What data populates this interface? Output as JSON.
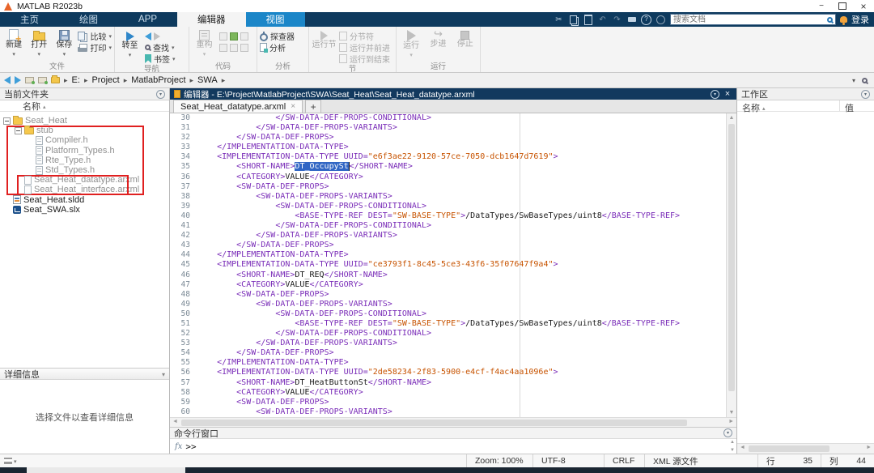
{
  "window": {
    "title": "MATLAB R2023b"
  },
  "icons": {
    "matlab-logo": "orange-triangle",
    "cut": "scissors",
    "copy": "two-pages",
    "paste": "clipboard",
    "undo": "arrow-counterclockwise",
    "redo": "arrow-clockwise",
    "print": "printer",
    "help": "question-mark",
    "community": "circle",
    "search": "magnifier",
    "bell": "notification-bell",
    "folder": "yellow-folder",
    "file": "document-page",
    "play": "triangle-right",
    "stop": "square"
  },
  "ribbon": {
    "tabs": [
      {
        "name": "home",
        "label": "主页"
      },
      {
        "name": "plots",
        "label": "绘图"
      },
      {
        "name": "apps",
        "label": "APP"
      },
      {
        "name": "editor",
        "label": "编辑器",
        "active": true
      },
      {
        "name": "view",
        "label": "视图",
        "view": true
      }
    ],
    "search_placeholder": "搜索文档",
    "signin": "登录",
    "groups": {
      "file": {
        "label": "文件",
        "new": "新建",
        "open": "打开",
        "save": "保存",
        "compare": "比较",
        "print": "打印"
      },
      "nav": {
        "label": "导航",
        "goto": "转至",
        "find": "查找",
        "bookmark": "书签"
      },
      "code": {
        "label": "代码",
        "refactor": "重构"
      },
      "analyze": {
        "label": "分析",
        "profiler": "探查器",
        "analyze": "分析"
      },
      "section": {
        "label": "节",
        "run_section": "运行节",
        "break": "分节符",
        "run_advance": "运行并前进",
        "run_end": "运行到结束"
      },
      "run": {
        "label": "运行",
        "run": "运行",
        "step": "步进",
        "stop": "停止"
      }
    }
  },
  "address_bar": {
    "path": [
      "E:",
      "Project",
      "MatlabProject",
      "SWA"
    ]
  },
  "current_folder": {
    "title": "当前文件夹",
    "name_column": "名称",
    "tree": [
      {
        "label": "Seat_Heat",
        "type": "folder",
        "level": 0,
        "expand": true,
        "gray": true
      },
      {
        "label": "stub",
        "type": "folder",
        "level": 1,
        "expand": true,
        "gray": true
      },
      {
        "label": "Compiler.h",
        "type": "hfile",
        "level": 2,
        "gray": true
      },
      {
        "label": "Platform_Types.h",
        "type": "hfile",
        "level": 2,
        "gray": true
      },
      {
        "label": "Rte_Type.h",
        "type": "hfile",
        "level": 2,
        "gray": true
      },
      {
        "label": "Std_Types.h",
        "type": "hfile",
        "level": 2,
        "gray": true
      },
      {
        "label": "Seat_Heat_datatype.arxml",
        "type": "file",
        "level": 1,
        "gray": true
      },
      {
        "label": "Seat_Heat_interface.arxml",
        "type": "file",
        "level": 1,
        "gray": true
      },
      {
        "label": "Seat_Heat.sldd",
        "type": "sldd",
        "level": 0,
        "gray": false
      },
      {
        "label": "Seat_SWA.slx",
        "type": "slx",
        "level": 0,
        "gray": false
      }
    ]
  },
  "details": {
    "title": "详细信息",
    "empty": "选择文件以查看详细信息"
  },
  "editor": {
    "titlebar": "编辑器 - E:\\Project\\MatlabProject\\SWA\\Seat_Heat\\Seat_Heat_datatype.arxml",
    "tab": "Seat_Heat_datatype.arxml",
    "lines": [
      {
        "n": "30",
        "p": [
          [
            "t",
            "                </SW-DATA-DEF-PROPS-CONDITIONAL>"
          ]
        ]
      },
      {
        "n": "31",
        "p": [
          [
            "t",
            "            </SW-DATA-DEF-PROPS-VARIANTS>"
          ]
        ]
      },
      {
        "n": "32",
        "p": [
          [
            "t",
            "        </SW-DATA-DEF-PROPS>"
          ]
        ]
      },
      {
        "n": "33",
        "p": [
          [
            "t",
            "    </IMPLEMENTATION-DATA-TYPE>"
          ]
        ]
      },
      {
        "n": "34",
        "p": [
          [
            "t",
            "    <IMPLEMENTATION-DATA-TYPE UUID="
          ],
          [
            "v",
            "\"e6f3ae22-9120-57ce-7050-dcb1647d7619\""
          ],
          [
            "t",
            ">"
          ]
        ]
      },
      {
        "n": "35",
        "p": [
          [
            "t",
            "        <SHORT-NAME>"
          ],
          [
            "s",
            "DT_OccupySt"
          ],
          [
            "t",
            "</SHORT-NAME>"
          ]
        ]
      },
      {
        "n": "36",
        "p": [
          [
            "t",
            "        <CATEGORY>"
          ],
          [
            "x",
            "VALUE"
          ],
          [
            "t",
            "</CATEGORY>"
          ]
        ]
      },
      {
        "n": "37",
        "p": [
          [
            "t",
            "        <SW-DATA-DEF-PROPS>"
          ]
        ]
      },
      {
        "n": "38",
        "p": [
          [
            "t",
            "            <SW-DATA-DEF-PROPS-VARIANTS>"
          ]
        ]
      },
      {
        "n": "39",
        "p": [
          [
            "t",
            "                <SW-DATA-DEF-PROPS-CONDITIONAL>"
          ]
        ]
      },
      {
        "n": "40",
        "p": [
          [
            "t",
            "                    <BASE-TYPE-REF DEST="
          ],
          [
            "v",
            "\"SW-BASE-TYPE\""
          ],
          [
            "t",
            ">"
          ],
          [
            "x",
            "/DataTypes/SwBaseTypes/uint8"
          ],
          [
            "t",
            "</BASE-TYPE-REF>"
          ]
        ]
      },
      {
        "n": "41",
        "p": [
          [
            "t",
            "                </SW-DATA-DEF-PROPS-CONDITIONAL>"
          ]
        ]
      },
      {
        "n": "42",
        "p": [
          [
            "t",
            "            </SW-DATA-DEF-PROPS-VARIANTS>"
          ]
        ]
      },
      {
        "n": "43",
        "p": [
          [
            "t",
            "        </SW-DATA-DEF-PROPS>"
          ]
        ]
      },
      {
        "n": "44",
        "p": [
          [
            "t",
            "    </IMPLEMENTATION-DATA-TYPE>"
          ]
        ]
      },
      {
        "n": "45",
        "p": [
          [
            "t",
            "    <IMPLEMENTATION-DATA-TYPE UUID="
          ],
          [
            "v",
            "\"ce3793f1-8c45-5ce3-43f6-35f07647f9a4\""
          ],
          [
            "t",
            ">"
          ]
        ]
      },
      {
        "n": "46",
        "p": [
          [
            "t",
            "        <SHORT-NAME>"
          ],
          [
            "x",
            "DT_REQ"
          ],
          [
            "t",
            "</SHORT-NAME>"
          ]
        ]
      },
      {
        "n": "47",
        "p": [
          [
            "t",
            "        <CATEGORY>"
          ],
          [
            "x",
            "VALUE"
          ],
          [
            "t",
            "</CATEGORY>"
          ]
        ]
      },
      {
        "n": "48",
        "p": [
          [
            "t",
            "        <SW-DATA-DEF-PROPS>"
          ]
        ]
      },
      {
        "n": "49",
        "p": [
          [
            "t",
            "            <SW-DATA-DEF-PROPS-VARIANTS>"
          ]
        ]
      },
      {
        "n": "50",
        "p": [
          [
            "t",
            "                <SW-DATA-DEF-PROPS-CONDITIONAL>"
          ]
        ]
      },
      {
        "n": "51",
        "p": [
          [
            "t",
            "                    <BASE-TYPE-REF DEST="
          ],
          [
            "v",
            "\"SW-BASE-TYPE\""
          ],
          [
            "t",
            ">"
          ],
          [
            "x",
            "/DataTypes/SwBaseTypes/uint8"
          ],
          [
            "t",
            "</BASE-TYPE-REF>"
          ]
        ]
      },
      {
        "n": "52",
        "p": [
          [
            "t",
            "                </SW-DATA-DEF-PROPS-CONDITIONAL>"
          ]
        ]
      },
      {
        "n": "53",
        "p": [
          [
            "t",
            "            </SW-DATA-DEF-PROPS-VARIANTS>"
          ]
        ]
      },
      {
        "n": "54",
        "p": [
          [
            "t",
            "        </SW-DATA-DEF-PROPS>"
          ]
        ]
      },
      {
        "n": "55",
        "p": [
          [
            "t",
            "    </IMPLEMENTATION-DATA-TYPE>"
          ]
        ]
      },
      {
        "n": "56",
        "p": [
          [
            "t",
            "    <IMPLEMENTATION-DATA-TYPE UUID="
          ],
          [
            "v",
            "\"2de58234-2f83-5900-e4cf-f4ac4aa1096e\""
          ],
          [
            "t",
            ">"
          ]
        ]
      },
      {
        "n": "57",
        "p": [
          [
            "t",
            "        <SHORT-NAME>"
          ],
          [
            "x",
            "DT_HeatButtonSt"
          ],
          [
            "t",
            "</SHORT-NAME>"
          ]
        ]
      },
      {
        "n": "58",
        "p": [
          [
            "t",
            "        <CATEGORY>"
          ],
          [
            "x",
            "VALUE"
          ],
          [
            "t",
            "</CATEGORY>"
          ]
        ]
      },
      {
        "n": "59",
        "p": [
          [
            "t",
            "        <SW-DATA-DEF-PROPS>"
          ]
        ]
      },
      {
        "n": "60",
        "p": [
          [
            "t",
            "            <SW-DATA-DEF-PROPS-VARIANTS>"
          ]
        ]
      }
    ]
  },
  "command_window": {
    "title": "命令行窗口",
    "fx": "fx",
    "prompt": ">>"
  },
  "workspace": {
    "title": "工作区",
    "name_column": "名称",
    "value_column": "值"
  },
  "status_bar": {
    "zoom": "Zoom: 100%",
    "encoding": "UTF-8",
    "eol": "CRLF",
    "filetype": "XML 源文件",
    "line_label": "行",
    "line": "35",
    "col_label": "列",
    "col": "44"
  }
}
